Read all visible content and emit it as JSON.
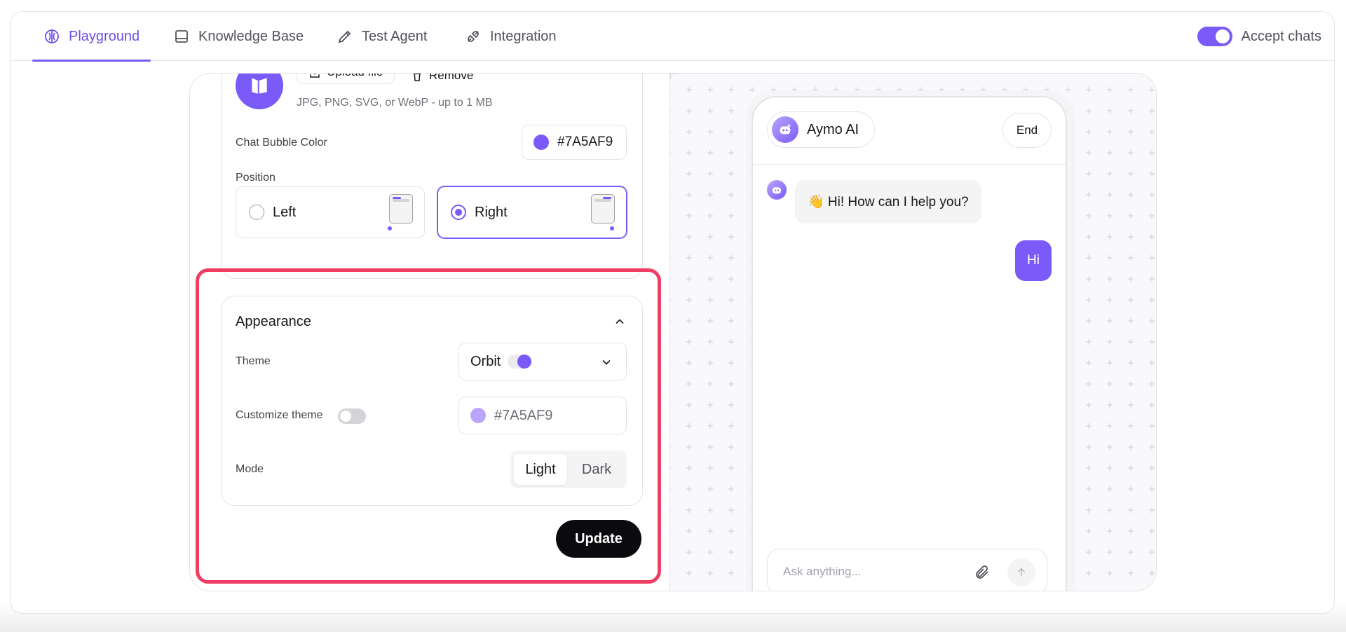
{
  "nav": {
    "tabs": [
      {
        "label": "Playground",
        "icon": "brain-icon"
      },
      {
        "label": "Knowledge Base",
        "icon": "book-icon"
      },
      {
        "label": "Test Agent",
        "icon": "pen-icon"
      },
      {
        "label": "Integration",
        "icon": "plug-icon"
      }
    ],
    "accept_label": "Accept chats"
  },
  "branding": {
    "upload_label": "Upload file",
    "remove_label": "Remove",
    "file_hint": "JPG, PNG, SVG, or WebP - up to 1 MB",
    "bubble_color_label": "Chat Bubble Color",
    "bubble_color_value": "#7A5AF9",
    "position_label": "Position",
    "position_options": [
      "Left",
      "Right"
    ],
    "position_selected": "Right"
  },
  "appearance": {
    "title": "Appearance",
    "theme_label": "Theme",
    "theme_value": "Orbit",
    "customize_label": "Customize theme",
    "customize_color_placeholder": "#7A5AF9",
    "mode_label": "Mode",
    "mode_options": [
      "Light",
      "Dark"
    ],
    "mode_selected": "Light",
    "update_label": "Update"
  },
  "preview": {
    "agent_name": "Aymo AI",
    "end_label": "End",
    "bot_message": "👋 Hi! How can I help you?",
    "user_message": "Hi",
    "input_placeholder": "Ask anything..."
  },
  "colors": {
    "accent": "#7A5AF9",
    "highlight": "#ef3d64"
  }
}
